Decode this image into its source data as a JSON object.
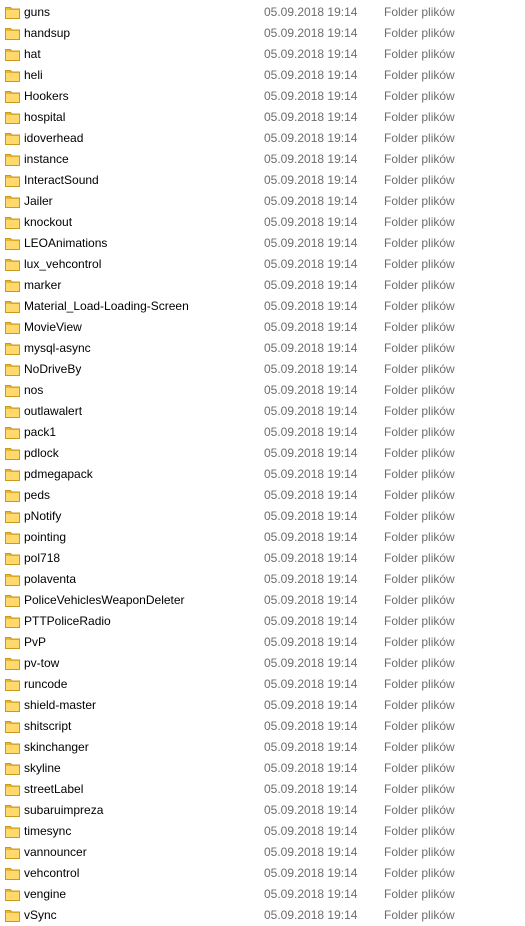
{
  "colors": {
    "folder_body": "#e8b632",
    "folder_tab": "#ffd96b",
    "meta_text": "#6d6d6d",
    "name_text": "#000000"
  },
  "icon": "folder-icon",
  "rows": [
    {
      "name": "guns",
      "date": "05.09.2018 19:14",
      "type": "Folder plików"
    },
    {
      "name": "handsup",
      "date": "05.09.2018 19:14",
      "type": "Folder plików"
    },
    {
      "name": "hat",
      "date": "05.09.2018 19:14",
      "type": "Folder plików"
    },
    {
      "name": "heli",
      "date": "05.09.2018 19:14",
      "type": "Folder plików"
    },
    {
      "name": "Hookers",
      "date": "05.09.2018 19:14",
      "type": "Folder plików"
    },
    {
      "name": "hospital",
      "date": "05.09.2018 19:14",
      "type": "Folder plików"
    },
    {
      "name": "idoverhead",
      "date": "05.09.2018 19:14",
      "type": "Folder plików"
    },
    {
      "name": "instance",
      "date": "05.09.2018 19:14",
      "type": "Folder plików"
    },
    {
      "name": "InteractSound",
      "date": "05.09.2018 19:14",
      "type": "Folder plików"
    },
    {
      "name": "Jailer",
      "date": "05.09.2018 19:14",
      "type": "Folder plików"
    },
    {
      "name": "knockout",
      "date": "05.09.2018 19:14",
      "type": "Folder plików"
    },
    {
      "name": "LEOAnimations",
      "date": "05.09.2018 19:14",
      "type": "Folder plików"
    },
    {
      "name": "lux_vehcontrol",
      "date": "05.09.2018 19:14",
      "type": "Folder plików"
    },
    {
      "name": "marker",
      "date": "05.09.2018 19:14",
      "type": "Folder plików"
    },
    {
      "name": "Material_Load-Loading-Screen",
      "date": "05.09.2018 19:14",
      "type": "Folder plików"
    },
    {
      "name": "MovieView",
      "date": "05.09.2018 19:14",
      "type": "Folder plików"
    },
    {
      "name": "mysql-async",
      "date": "05.09.2018 19:14",
      "type": "Folder plików"
    },
    {
      "name": "NoDriveBy",
      "date": "05.09.2018 19:14",
      "type": "Folder plików"
    },
    {
      "name": "nos",
      "date": "05.09.2018 19:14",
      "type": "Folder plików"
    },
    {
      "name": "outlawalert",
      "date": "05.09.2018 19:14",
      "type": "Folder plików"
    },
    {
      "name": "pack1",
      "date": "05.09.2018 19:14",
      "type": "Folder plików"
    },
    {
      "name": "pdlock",
      "date": "05.09.2018 19:14",
      "type": "Folder plików"
    },
    {
      "name": "pdmegapack",
      "date": "05.09.2018 19:14",
      "type": "Folder plików"
    },
    {
      "name": "peds",
      "date": "05.09.2018 19:14",
      "type": "Folder plików"
    },
    {
      "name": "pNotify",
      "date": "05.09.2018 19:14",
      "type": "Folder plików"
    },
    {
      "name": "pointing",
      "date": "05.09.2018 19:14",
      "type": "Folder plików"
    },
    {
      "name": "pol718",
      "date": "05.09.2018 19:14",
      "type": "Folder plików"
    },
    {
      "name": "polaventa",
      "date": "05.09.2018 19:14",
      "type": "Folder plików"
    },
    {
      "name": "PoliceVehiclesWeaponDeleter",
      "date": "05.09.2018 19:14",
      "type": "Folder plików"
    },
    {
      "name": "PTTPoliceRadio",
      "date": "05.09.2018 19:14",
      "type": "Folder plików"
    },
    {
      "name": "PvP",
      "date": "05.09.2018 19:14",
      "type": "Folder plików"
    },
    {
      "name": "pv-tow",
      "date": "05.09.2018 19:14",
      "type": "Folder plików"
    },
    {
      "name": "runcode",
      "date": "05.09.2018 19:14",
      "type": "Folder plików"
    },
    {
      "name": "shield-master",
      "date": "05.09.2018 19:14",
      "type": "Folder plików"
    },
    {
      "name": "shitscript",
      "date": "05.09.2018 19:14",
      "type": "Folder plików"
    },
    {
      "name": "skinchanger",
      "date": "05.09.2018 19:14",
      "type": "Folder plików"
    },
    {
      "name": "skyline",
      "date": "05.09.2018 19:14",
      "type": "Folder plików"
    },
    {
      "name": "streetLabel",
      "date": "05.09.2018 19:14",
      "type": "Folder plików"
    },
    {
      "name": "subaruimpreza",
      "date": "05.09.2018 19:14",
      "type": "Folder plików"
    },
    {
      "name": "timesync",
      "date": "05.09.2018 19:14",
      "type": "Folder plików"
    },
    {
      "name": "vannouncer",
      "date": "05.09.2018 19:14",
      "type": "Folder plików"
    },
    {
      "name": "vehcontrol",
      "date": "05.09.2018 19:14",
      "type": "Folder plików"
    },
    {
      "name": "vengine",
      "date": "05.09.2018 19:14",
      "type": "Folder plików"
    },
    {
      "name": "vSync",
      "date": "05.09.2018 19:14",
      "type": "Folder plików"
    }
  ]
}
